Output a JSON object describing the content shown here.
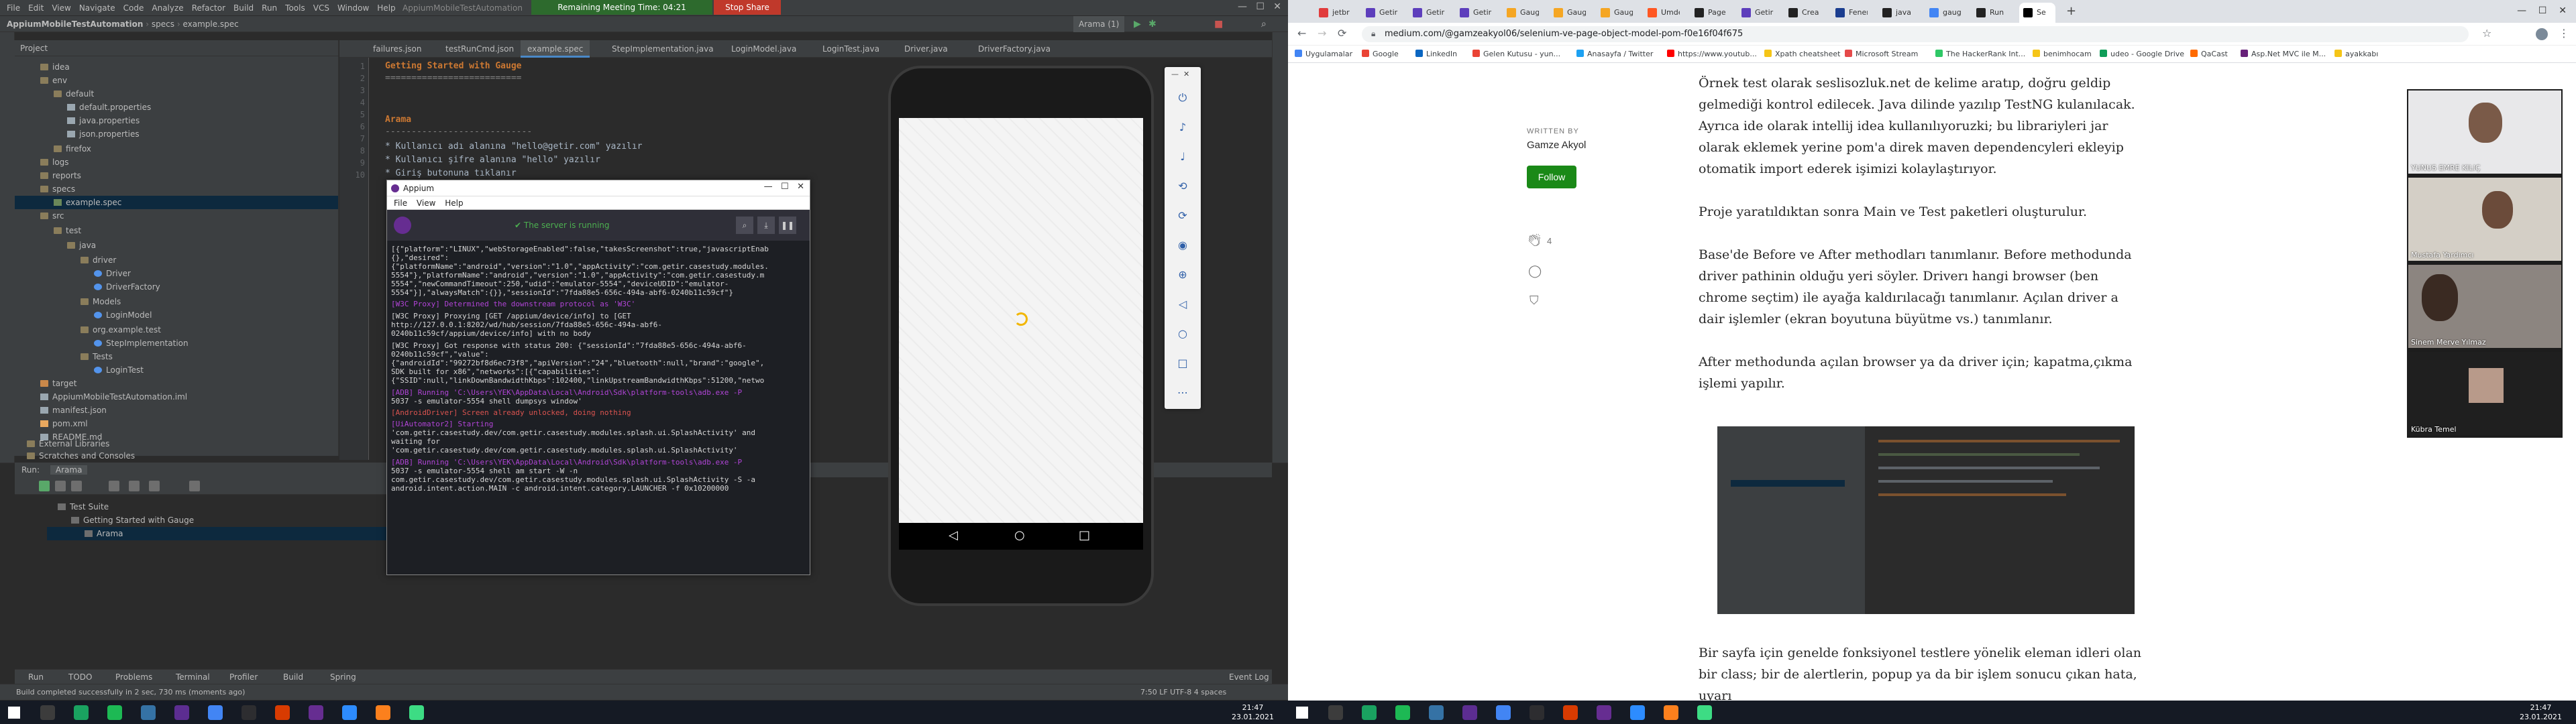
{
  "ide": {
    "menu": [
      "File",
      "Edit",
      "View",
      "Navigate",
      "Code",
      "Analyze",
      "Refactor",
      "Build",
      "Run",
      "Tools",
      "VCS",
      "Window",
      "Help"
    ],
    "window_title": "AppiumMobileTestAutomation",
    "meeting_text": "Remaining Meeting Time: 04:21",
    "stop_share": "Stop Share",
    "breadcrumb": [
      "AppiumMobileTestAutomation",
      "specs",
      "example.spec"
    ],
    "run_config": "Arama (1)",
    "project_header": "Project",
    "tree": [
      "idea",
      "env",
      "default",
      "default.properties",
      "java.properties",
      "json.properties",
      "firefox",
      "logs",
      "reports",
      "specs",
      "example.spec",
      "src",
      "test",
      "java",
      "driver",
      "Driver",
      "DriverFactory",
      "Models",
      "LoginModel",
      "org.example.test",
      "StepImplementation",
      "Tests",
      "LoginTest",
      "target",
      "AppiumMobileTestAutomation.iml",
      "manifest.json",
      "pom.xml",
      "README.md",
      "External Libraries",
      "Scratches and Consoles"
    ],
    "tabs": [
      "failures.json",
      "testRunCmd.json",
      "example.spec",
      "StepImplementation.java",
      "LoginModel.java",
      "LoginTest.java",
      "Driver.java",
      "DriverFactory.java"
    ],
    "code": {
      "l1": "Getting Started with Gauge",
      "l2": "==========================",
      "l3": "Arama",
      "l4": "----------------------------",
      "l5": "* Kullanıcı adı alanına \"hello@getir.com\" yazılır",
      "l6": "* Kullanıcı şifre alanına \"hello\" yazılır",
      "l7": "* Giriş butonuna tıklanır"
    },
    "run_label": "Run:",
    "run_tab": "Arama",
    "run_tree": [
      "Test Suite",
      "Getting Started with Gauge",
      "Arama"
    ],
    "bottom_tabs": [
      "Run",
      "TODO",
      "Problems",
      "Terminal",
      "Profiler",
      "Build",
      "Spring"
    ],
    "event_log": "Event Log",
    "status_left": "Build completed successfully in 2 sec, 730 ms (moments ago)",
    "status_right": "7:50   LF   UTF-8   4 spaces"
  },
  "appium": {
    "title": "Appium",
    "menu": [
      "File",
      "View",
      "Help"
    ],
    "server_status": "The server is running",
    "log": [
      "[{\"platform\":\"LINUX\",\"webStorageEnabled\":false,\"takesScreenshot\":true,\"javascriptEnab",
      "{},\"desired\":",
      "{\"platformName\":\"android\",\"version\":\"1.0\",\"appActivity\":\"com.getir.casestudy.modules.",
      "5554\"},\"platformName\":\"android\",\"version\":\"1.0\",\"appActivity\":\"com.getir.casestudy.m",
      "5554\",\"newCommandTimeout\":250,\"udid\":\"emulator-5554\",\"deviceUDID\":\"emulator-",
      "5554\"}],\"alwaysMatch\":{}},\"sessionId\":\"7fda88e5-656c-494a-abf6-0240b11c59cf\"}",
      "[W3C Proxy] Determined the downstream protocol as 'W3C'",
      "[W3C Proxy] Proxying [GET /appium/device/info] to [GET",
      "http://127.0.0.1:8202/wd/hub/session/7fda88e5-656c-494a-abf6-",
      "0240b11c59cf/appium/device/info] with no body",
      "[W3C Proxy] Got response with status 200: {\"sessionId\":\"7fda88e5-656c-494a-abf6-",
      "0240b11c59cf\",\"value\":",
      "{\"androidId\":\"99272bf8d6ec73f8\",\"apiVersion\":\"24\",\"bluetooth\":null,\"brand\":\"google\",",
      "SDK built for x86\",\"networks\":[{\"capabilities\":",
      "{\"SSID\":null,\"linkDownBandwidthKbps\":102400,\"linkUpstreamBandwidthKbps\":51200,\"netwo",
      "[ADB] Running 'C:\\Users\\YEK\\AppData\\Local\\Android\\Sdk\\platform-tools\\adb.exe -P",
      "5037 -s emulator-5554 shell dumpsys window'",
      "[AndroidDriver] Screen already unlocked, doing nothing",
      "[UiAutomator2] Starting",
      "'com.getir.casestudy.dev/com.getir.casestudy.modules.splash.ui.SplashActivity' and",
      "waiting for",
      "'com.getir.casestudy.dev/com.getir.casestudy.modules.splash.ui.SplashActivity'",
      "[ADB] Running 'C:\\Users\\YEK\\AppData\\Local\\Android\\Sdk\\platform-tools\\adb.exe -P",
      "5037 -s emulator-5554 shell am start -W -n",
      "com.getir.casestudy.dev/com.getir.casestudy.modules.splash.ui.SplashActivity -S -a",
      "android.intent.action.MAIN -c android.intent.category.LAUNCHER -f 0x10200000"
    ]
  },
  "taskbar_left": {
    "time": "21:47",
    "date": "23.01.2021"
  },
  "taskbar_right": {
    "time": "21:47",
    "date": "23.01.2021"
  },
  "chrome": {
    "tabs": [
      "jetbr",
      "Getir",
      "Getir",
      "Getir",
      "Gauge",
      "Gauge",
      "Gauge",
      "Umde",
      "Page",
      "Getir",
      "Crea",
      "Fenerbah",
      "java",
      "gauge",
      "Run",
      "Se"
    ],
    "url": "medium.com/@gamzeakyol06/selenium-ve-page-object-model-pom-f0e16f04f675",
    "bookmarks": [
      "Uygulamalar",
      "Google",
      "LinkedIn",
      "Gelen Kutusu - yun...",
      "Anasayfa / Twitter",
      "https://www.youtub...",
      "Xpath cheatsheet",
      "Microsoft Stream",
      "The HackerRank Int...",
      "benimhocam",
      "udeo - Google Drive",
      "QaCast",
      "Asp.Net MVC ile M...",
      "ayakkabı"
    ],
    "written_by": "WRITTEN BY",
    "author": "Gamze Akyol",
    "follow": "Follow",
    "claps": "4",
    "paragraphs": [
      "Örnek test olarak seslisozluk.net de kelime aratıp, doğru geldip gelmediği kontrol edilecek. Java dilinde yazılıp TestNG kulanılacak. Ayrıca ide olarak intellij idea kullanılıyoruzki; bu librariyleri jar olarak eklemek yerine pom'a direk maven dependencyleri ekleyip otomatik import ederek işimizi kolaylaştırıyor.",
      "Proje yaratıldıktan sonra Main ve Test paketleri oluşturulur.",
      "Base'de Before ve After methodları tanımlanır. Before methodunda driver pathinin olduğu yeri söyler. Driverı hangi browser (ben chrome seçtim) ile ayağa kaldırılacağı tanımlanır. Açılan driver a dair işlemler (ekran boyutuna büyütme vs.) tanımlanır.",
      "After methodunda açılan browser ya da driver için; kapatma,çıkma işlemi yapılır.",
      "Bir sayfa için genelde fonksiyonel testlere yönelik eleman idleri olan bir class; bir de alertlerin, popup ya da bir işlem sonucu çıkan hata, uyarı"
    ]
  },
  "zoom": {
    "participants": [
      "YUNUS EMRE KILIÇ",
      "Mustafa Yardımcı",
      "Sinem Merve Yılmaz",
      "Kübra Temel"
    ]
  }
}
